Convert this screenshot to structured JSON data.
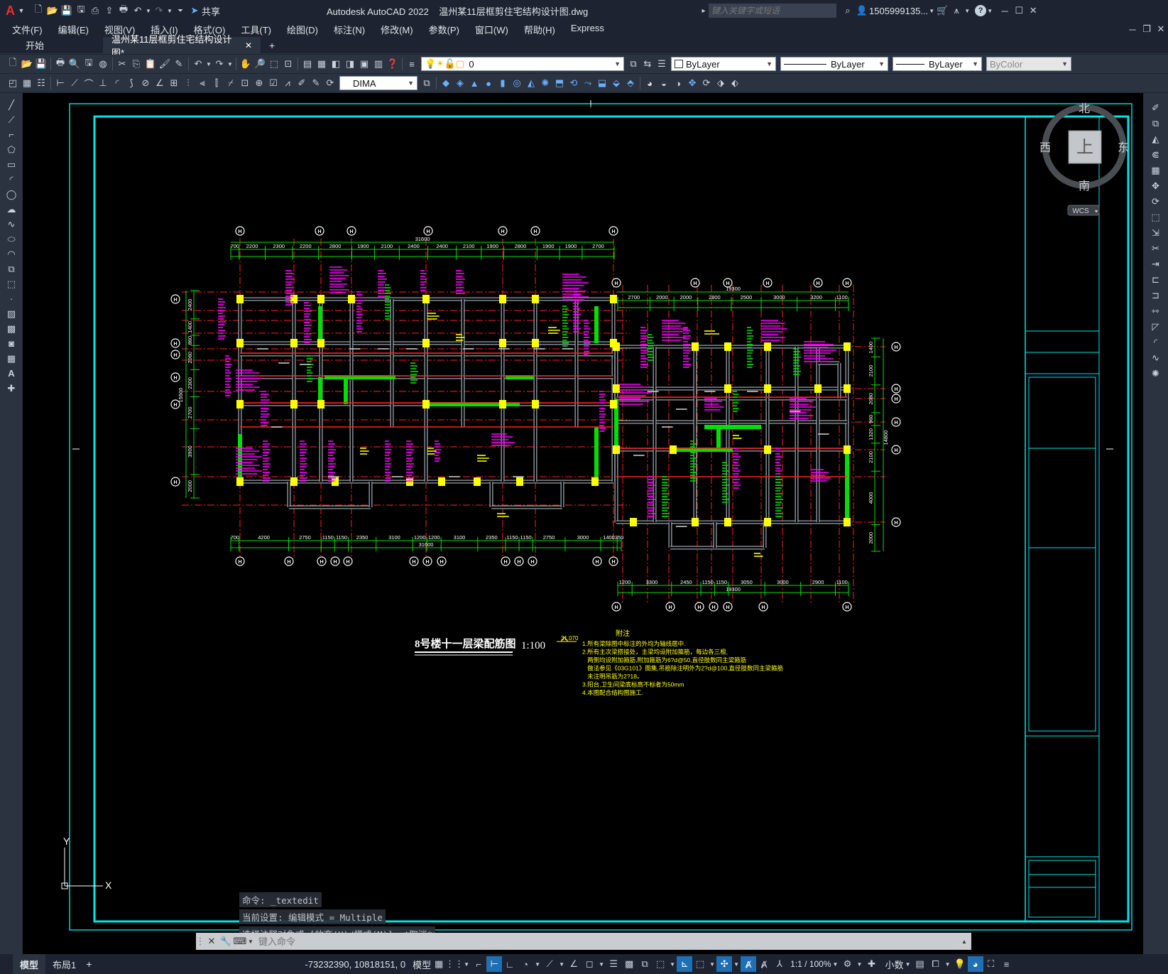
{
  "app": {
    "title": "Autodesk AutoCAD 2022    温州某11层框剪住宅结构设计图.dwg",
    "share_label": "共享",
    "search_placeholder": "键入关键字或短语",
    "user": "1505999135...",
    "accent": "#e8312a"
  },
  "menu": [
    "文件(F)",
    "编辑(E)",
    "视图(V)",
    "插入(I)",
    "格式(O)",
    "工具(T)",
    "绘图(D)",
    "标注(N)",
    "修改(M)",
    "参数(P)",
    "窗口(W)",
    "帮助(H)",
    "Express"
  ],
  "tabs": {
    "start": "开始",
    "doc": "温州某11层框剪住宅结构设计图*",
    "close": "✕",
    "add": "+"
  },
  "toolbar": {
    "layer_value": "0",
    "color_value": "ByLayer",
    "linetype_value": "ByLayer",
    "lineweight_value": "ByLayer",
    "plotstyle_value": "ByColor",
    "dimstyle_value": "DIMA"
  },
  "viewcube": {
    "north": "北",
    "south": "南",
    "east": "东",
    "west": "西",
    "top": "上",
    "wcs": "WCS"
  },
  "drawing": {
    "title": "8号楼十一层梁配筋图",
    "scale": "1:100",
    "elevation": "31.070",
    "notes_title": "附注",
    "notes": [
      "1.所有梁除图中标注的外均为轴线居中.",
      "2.所有主次梁搭接处，主梁均设附加箍筋，每边各三根,",
      "   两侧均设附加箍筋,附加箍筋为6?d@50,直径肢数同主梁箍筋",
      "   做法参见《03G101》图集,吊筋除注明外为2?d@100,直径肢数同主梁箍筋",
      "   未注明吊筋为2?18。",
      "3.阳台,卫生间梁底标高不标者为50mm",
      "4.本图配合结构图施工."
    ],
    "top_dims": [
      "700",
      "2200",
      "2300",
      "2200",
      "2800",
      "1900",
      "2100",
      "2400",
      "2400",
      "2100",
      "1900",
      "2800",
      "1900",
      "1900",
      "2700"
    ],
    "top_total": "31600",
    "bottom_dims": [
      "700",
      "4200",
      "2750",
      "1150",
      "1150",
      "2350",
      "3100",
      "1200",
      "1200",
      "3100",
      "2350",
      "1150",
      "1150",
      "2750",
      "3000",
      "1400",
      "350"
    ],
    "bottom_total": "31600",
    "right_top_dims": [
      "2700",
      "2000",
      "2000",
      "2800",
      "2500",
      "3000",
      "3200",
      "1100"
    ],
    "right_top_total": "19300",
    "right_bottom_dims": [
      "1200",
      "3300",
      "2450",
      "1150",
      "1150",
      "3050",
      "3000",
      "2900",
      "1100"
    ],
    "right_bottom_total": "19300",
    "left_dims": [
      "2400",
      "1400",
      "860",
      "2060",
      "2300",
      "2700",
      "3900",
      "2000"
    ],
    "left_total": "15500",
    "right_dims": [
      "1400",
      "2100",
      "2080",
      "960",
      "1320",
      "2100",
      "4000",
      "2000"
    ],
    "right_total": "14800",
    "axis_label": "H"
  },
  "ucs": {
    "y": "Y",
    "x": "X"
  },
  "command": {
    "history": [
      "命令: _textedit",
      "当前设置: 编辑模式 = Multiple",
      "选择注释对象或 [放弃(U)/模式(M)]: *取消*"
    ],
    "placeholder": "键入命令"
  },
  "status": {
    "model_tab": "模型",
    "layout_tab": "布局1",
    "add": "+",
    "coords": "-73232390, 10818151, 0",
    "space": "模型",
    "scale": "1:1 / 100%",
    "units": "小数"
  }
}
